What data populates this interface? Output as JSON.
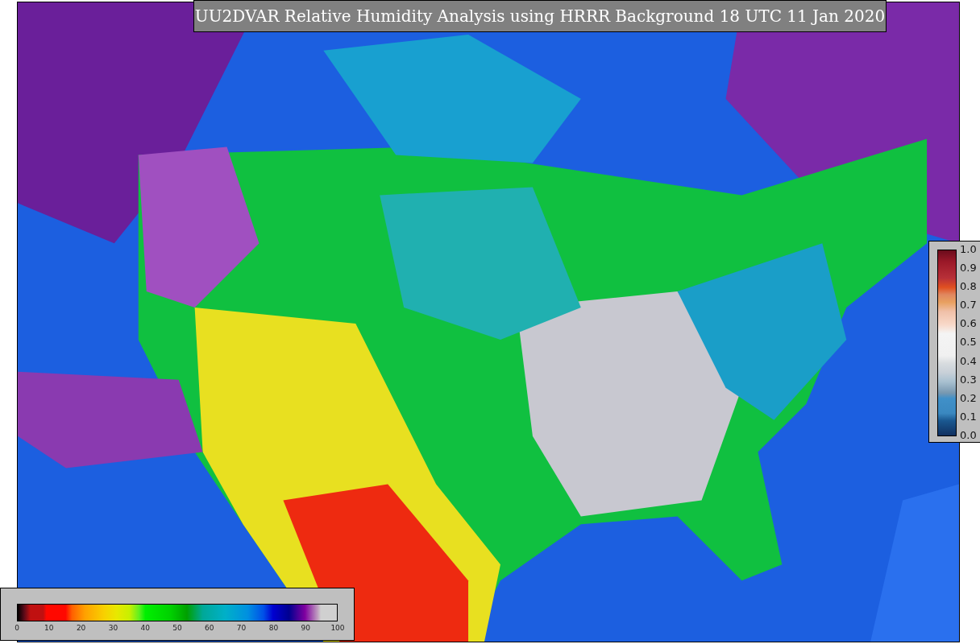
{
  "title": "UU2DVAR Relative Humidity Analysis using HRRR Background 18 UTC 11 Jan 2020",
  "humidity_colorbar": {
    "ticks": [
      "0",
      "10",
      "20",
      "30",
      "40",
      "50",
      "60",
      "70",
      "80",
      "90",
      "100"
    ]
  },
  "ratio_colorbar": {
    "ticks": [
      "1.0",
      "0.9",
      "0.8",
      "0.7",
      "0.6",
      "0.5",
      "0.4",
      "0.3",
      "0.2",
      "0.1",
      "0.0"
    ]
  }
}
